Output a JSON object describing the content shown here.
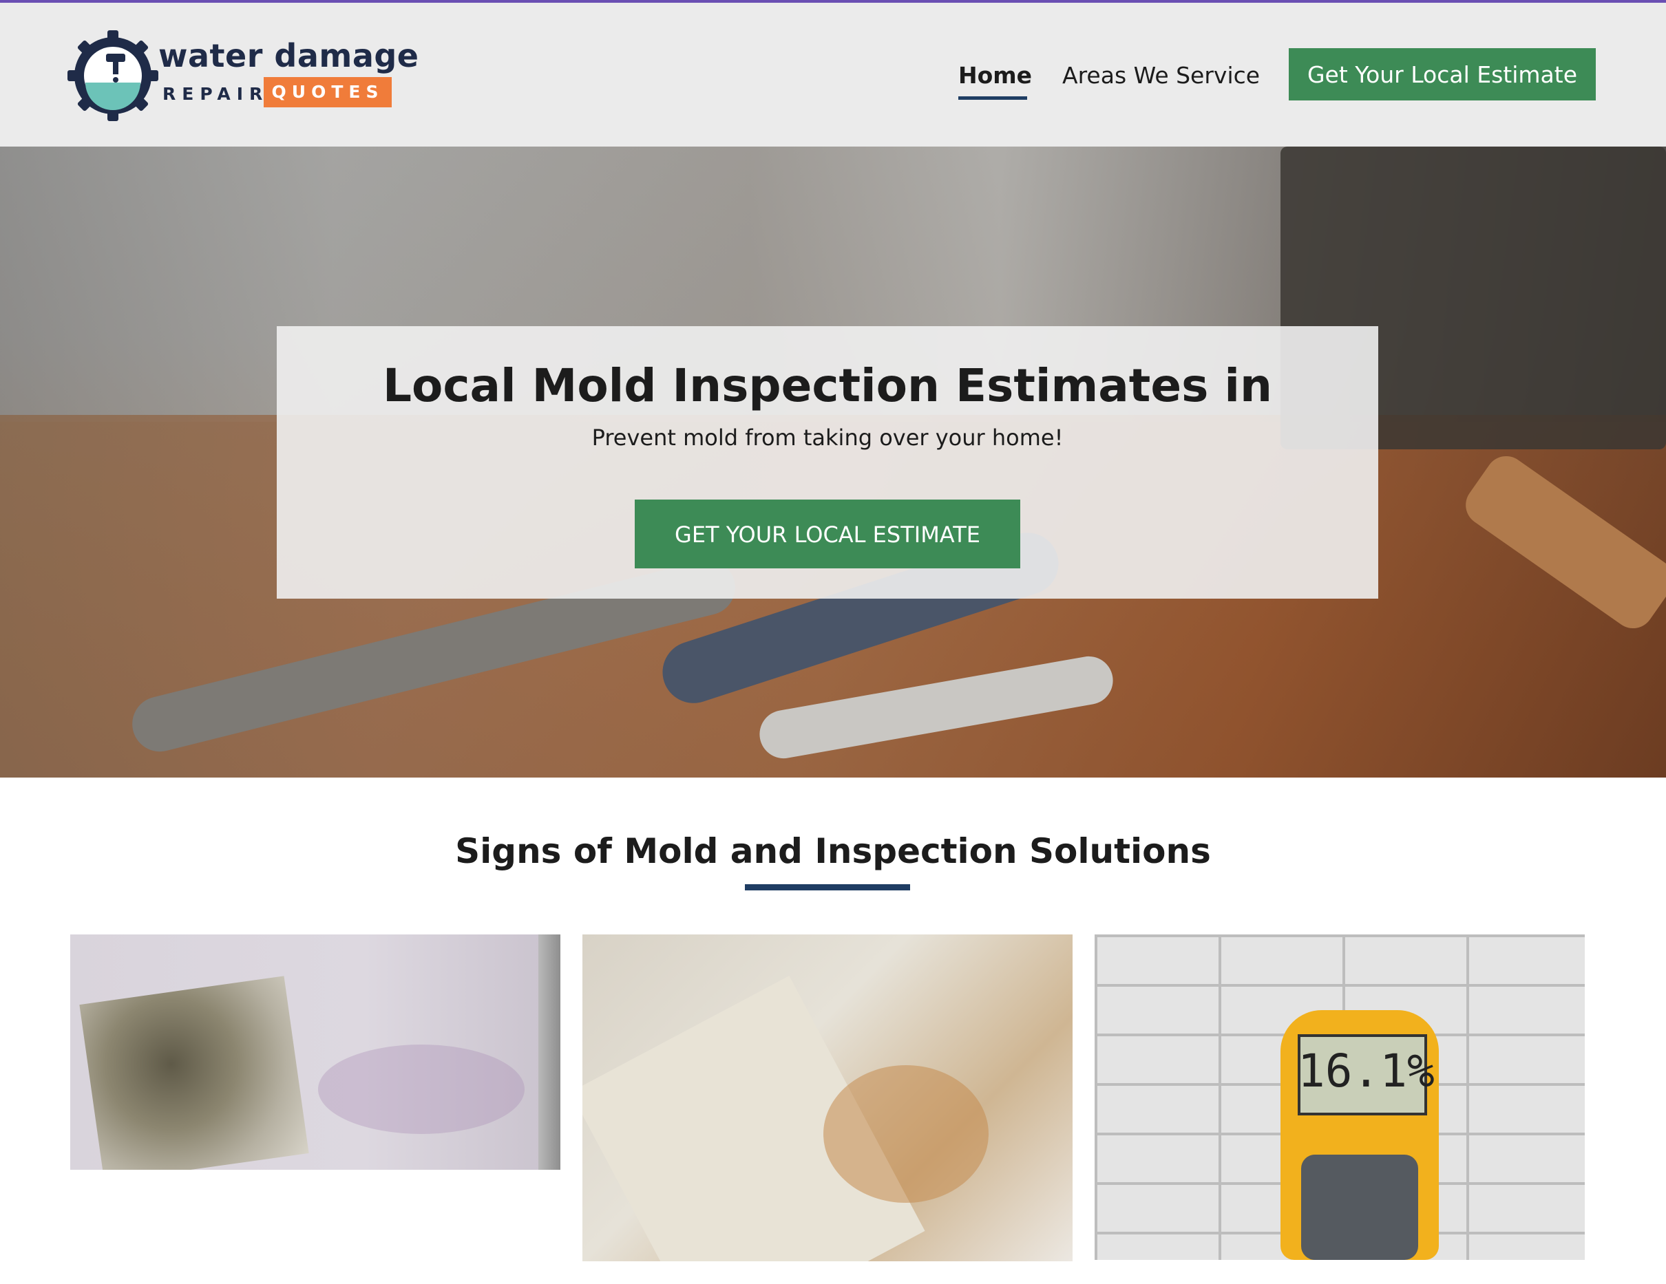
{
  "colors": {
    "accent_green": "#3d8b56",
    "navy": "#1f3d63",
    "logo_orange": "#f07c3a",
    "top_line": "#6a4fb3"
  },
  "header": {
    "logo": {
      "word1": "water damage",
      "word2": "REPAIR",
      "word3": "QUOTES",
      "icon": "gear-faucet-icon"
    },
    "nav": {
      "home": "Home",
      "areas": "Areas We Service",
      "cta": "Get Your Local Estimate"
    }
  },
  "hero": {
    "title": "Local Mold Inspection Estimates in",
    "subtitle": "Prevent mold from taking over your home!",
    "cta": "GET YOUR LOCAL ESTIMATE"
  },
  "section": {
    "title": "Signs of Mold and Inspection Solutions",
    "meter_reading": "16.1%"
  }
}
